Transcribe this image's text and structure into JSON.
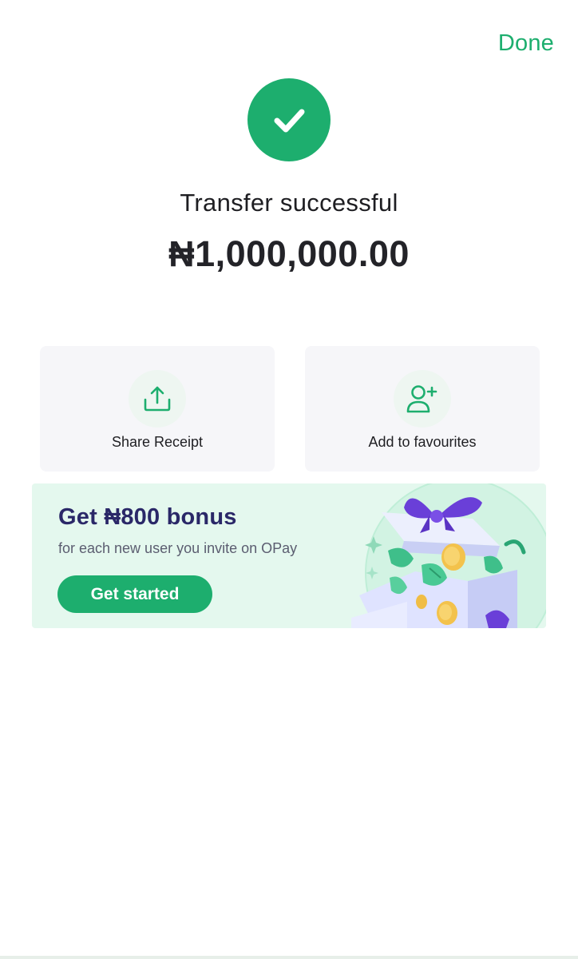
{
  "header": {
    "done_label": "Done"
  },
  "status": {
    "icon": "check-icon",
    "title": "Transfer successful",
    "amount": "₦1,000,000.00"
  },
  "actions": [
    {
      "label": "Share Receipt",
      "icon": "share-upload-icon"
    },
    {
      "label": "Add to favourites",
      "icon": "add-user-icon"
    }
  ],
  "promo": {
    "title": "Get ₦800 bonus",
    "subtitle": "for each new user you invite on OPay",
    "cta_label": "Get started",
    "art": "gift-box-illustration"
  },
  "colors": {
    "accent": "#1dae6e",
    "promo_background": "#e4f8ee",
    "promo_title": "#2a2868",
    "card_background": "#f6f6f9"
  }
}
